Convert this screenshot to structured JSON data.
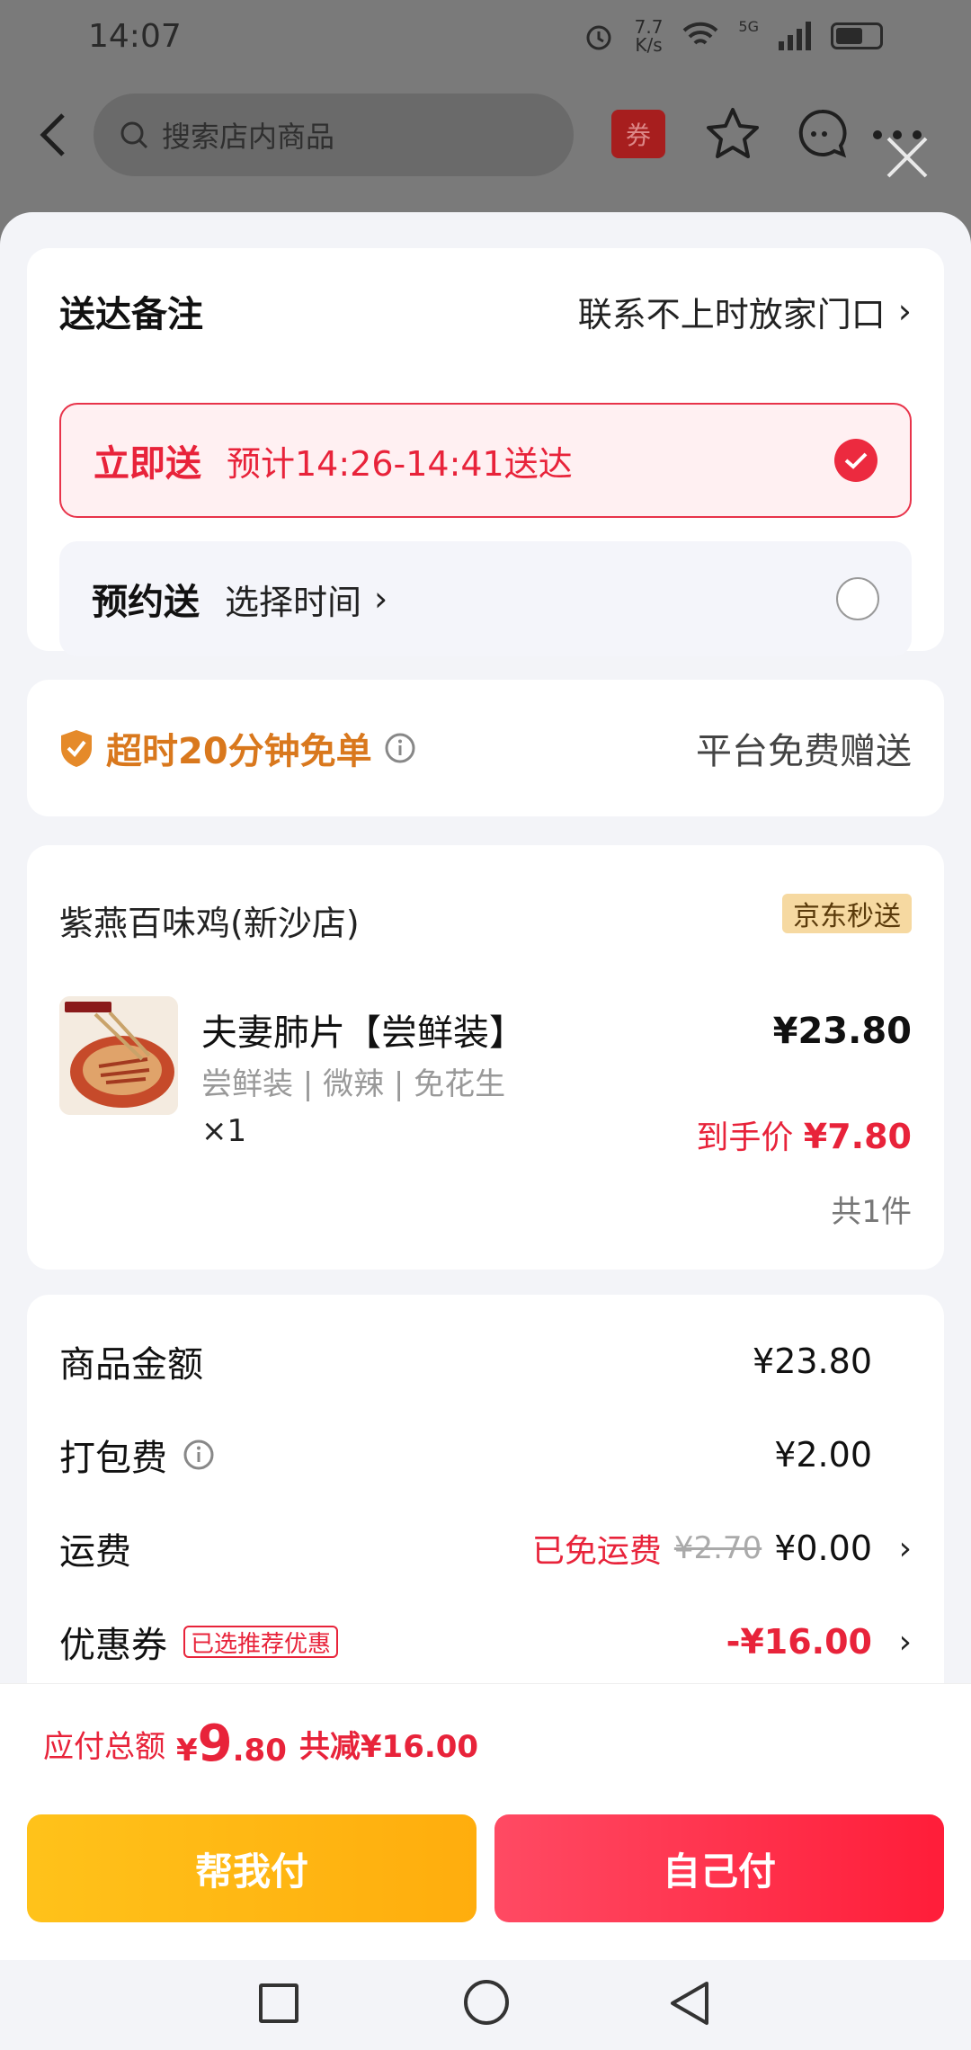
{
  "status_bar": {
    "time": "14:07",
    "speed_value": "7.7",
    "speed_unit": "K/s",
    "network": "5G"
  },
  "top_nav": {
    "search_placeholder": "搜索店内商品",
    "coupon_label": "券"
  },
  "delivery": {
    "remark_title": "送达备注",
    "remark_value": "联系不上时放家门口",
    "now_title": "立即送",
    "now_eta": "预计14:26-14:41送达",
    "later_title": "预约送",
    "later_action": "选择时间"
  },
  "guarantee": {
    "text": "超时20分钟免单",
    "note": "平台免费赠送"
  },
  "order": {
    "shop_name": "紫燕百味鸡(新沙店)",
    "shop_badge": "京东秒送",
    "item_name": "夫妻肺片【尝鲜装】",
    "item_spec": "尝鲜装 | 微辣 | 免花生",
    "item_qty": "×1",
    "item_price": "¥23.80",
    "final_label": "到手价",
    "final_price": "¥7.80",
    "count": "共1件"
  },
  "fees": {
    "goods_label": "商品金额",
    "goods_value": "¥23.80",
    "packing_label": "打包费",
    "packing_value": "¥2.00",
    "shipping_label": "运费",
    "shipping_free": "已免运费",
    "shipping_old": "¥2.70",
    "shipping_value": "¥0.00",
    "coupon_label": "优惠券",
    "coupon_tag": "已选推荐优惠",
    "coupon_value": "-¥16.00"
  },
  "pay": {
    "total_label": "应付总额",
    "currency": "¥",
    "total_int": "9",
    "total_dec": ".80",
    "discount": "共减¥16.00",
    "help_button": "帮我付",
    "self_button": "自己付"
  },
  "colors": {
    "accent_red": "#e8233a",
    "accent_orange": "#d9781d",
    "help_yellow": "#ffc21a"
  }
}
